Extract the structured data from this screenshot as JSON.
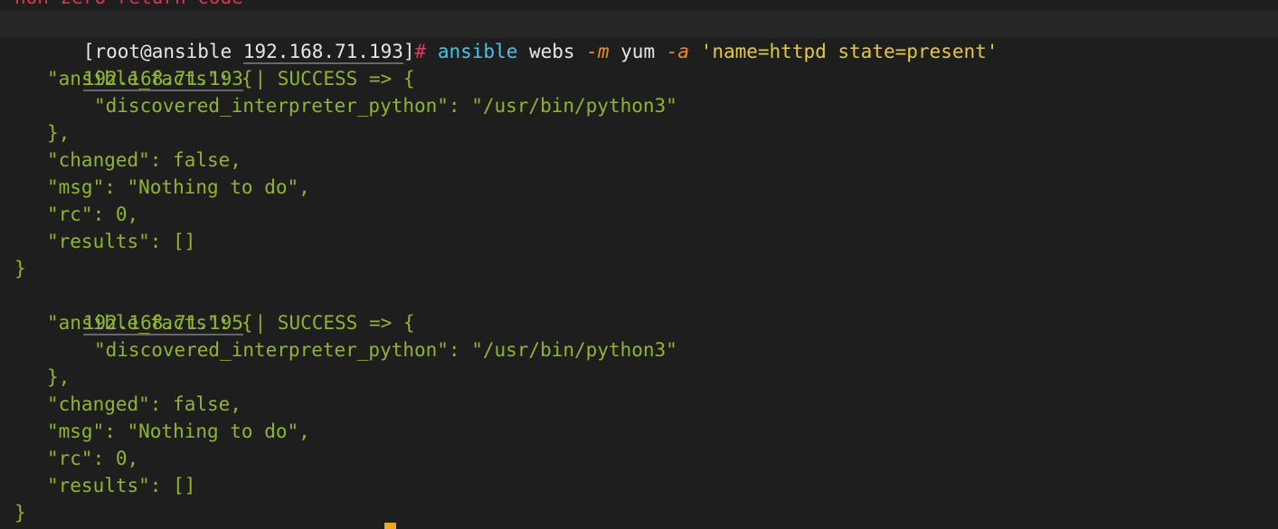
{
  "terminal": {
    "previous_line": "non-zero return code",
    "prompt": {
      "user_host": "[root@ansible ",
      "ip": "192.168.71.193",
      "close": "]",
      "hash": "#",
      "command": " ansible",
      "arg1": " webs ",
      "flag_m": "-m",
      "arg2": " yum ",
      "flag_a": "-a",
      "arg3": " 'name=httpd state=present'"
    },
    "hosts": [
      {
        "ip": "192.168.71.193",
        "status": " | SUCCESS => {",
        "ansible_facts": "\"ansible_facts\": {",
        "interpreter": "\"discovered_interpreter_python\": \"/usr/bin/python3\"",
        "facts_close": "},",
        "changed": "\"changed\": false,",
        "msg": "\"msg\": \"Nothing to do\",",
        "rc": "\"rc\": 0,",
        "results": "\"results\": []",
        "close": "}"
      },
      {
        "ip": "192.168.71.195",
        "status": " | SUCCESS => {",
        "ansible_facts": "\"ansible_facts\": {",
        "interpreter": "\"discovered_interpreter_python\": \"/usr/bin/python3\"",
        "facts_close": "},",
        "changed": "\"changed\": false,",
        "msg": "\"msg\": \"Nothing to do\",",
        "rc": "\"rc\": 0,",
        "results": "\"results\": []",
        "close": "}"
      }
    ]
  }
}
